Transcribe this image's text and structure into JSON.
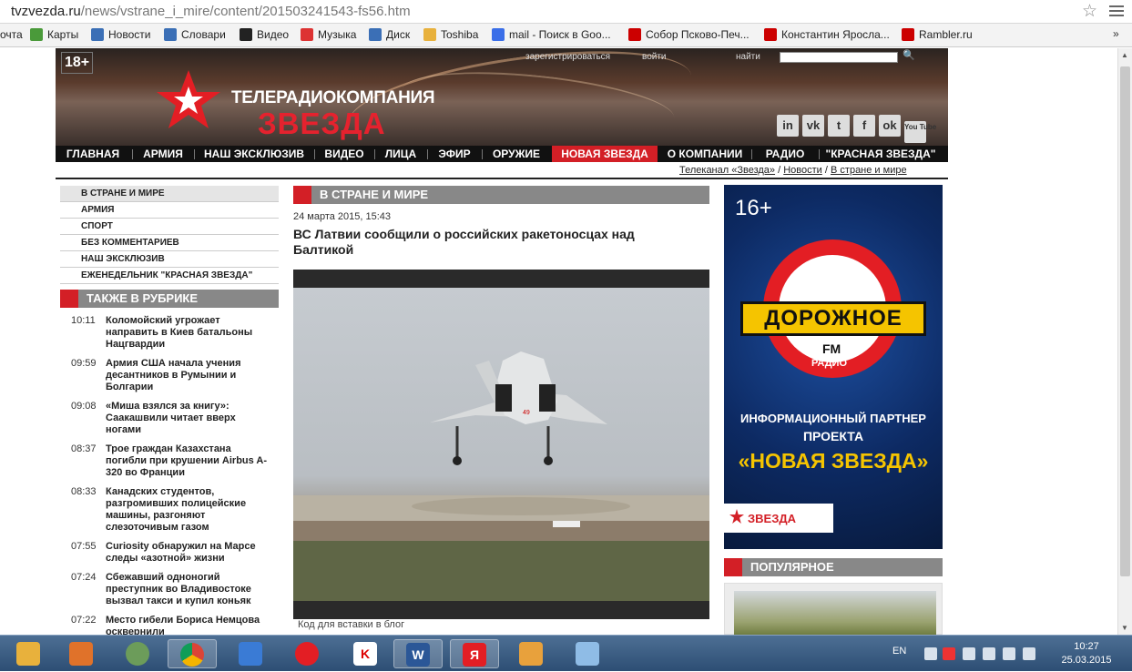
{
  "browser": {
    "url_host": "tvzvezda.ru",
    "url_path": "/news/vstrane_i_mire/content/201503241543-fs56.htm",
    "bookmarks": [
      "очта",
      "Карты",
      "Новости",
      "Словари",
      "Видео",
      "Музыка",
      "Диск",
      "Toshiba",
      "mail - Поиск в Goo...",
      "Собор Псково-Печ...",
      "Константин Яросла...",
      "Rambler.ru"
    ],
    "bookmark_more": "»",
    "bookmark_icons": [
      "#c33",
      "#4a9a3a",
      "#3b6fb6",
      "#3b6fb6",
      "#222",
      "#d33",
      "#3b6fb6",
      "#e8b13c",
      "#3a6ee8",
      "#c00",
      "#c00",
      "#c00"
    ]
  },
  "header": {
    "age": "18+",
    "register": "зарегистрироваться",
    "login": "войти",
    "search": "найти",
    "brand_line1": "ТЕЛЕРАДИОКОМПАНИЯ",
    "brand_line2": "ЗВЕЗДА",
    "social": [
      "in",
      "vk",
      "t",
      "f",
      "ok",
      "You Tube"
    ]
  },
  "nav": {
    "items": [
      "ГЛАВНАЯ",
      "АРМИЯ",
      "НАШ ЭКСКЛЮЗИВ",
      "ВИДЕО",
      "ЛИЦА",
      "ЭФИР",
      "ОРУЖИЕ",
      "НОВАЯ ЗВЕЗДА",
      "О КОМПАНИИ",
      "РАДИО",
      "\"КРАСНАЯ ЗВЕЗДА\""
    ],
    "active": "НОВАЯ ЗВЕЗДА"
  },
  "breadcrumbs": [
    "Телеканал «Звезда»",
    "Новости",
    "В стране и мире"
  ],
  "breadcrumb_sep": "/",
  "left_nav": [
    "В СТРАНЕ И МИРЕ",
    "АРМИЯ",
    "СПОРТ",
    "БЕЗ КОММЕНТАРИЕВ",
    "НАШ ЭКСКЛЮЗИВ",
    "ЕЖЕНЕДЕЛЬНИК \"КРАСНАЯ ЗВЕЗДА\""
  ],
  "also": {
    "title": "ТАКЖЕ В РУБРИКЕ",
    "items": [
      {
        "time": "10:11",
        "text": "Коломойский угрожает направить в Киев батальоны Нацгвардии"
      },
      {
        "time": "09:59",
        "text": "Армия США начала учения десантников в Румынии и Болгарии"
      },
      {
        "time": "09:08",
        "text": "«Миша взялся за книгу»: Саакашвили читает вверх ногами"
      },
      {
        "time": "08:37",
        "text": "Трое граждан Казахстана погибли при крушении Airbus A-320 во Франции"
      },
      {
        "time": "08:33",
        "text": "Канадских студентов, разгромивших полицейские машины, разгоняют слезоточивым газом"
      },
      {
        "time": "07:55",
        "text": "Curiosity обнаружил на Марсе следы «азотной» жизни"
      },
      {
        "time": "07:24",
        "text": "Сбежавший одноногий преступник во Владивостоке вызвал такси и купил коньяк"
      },
      {
        "time": "07:22",
        "text": "Место гибели Бориса Немцова осквернили"
      }
    ]
  },
  "article": {
    "section": "В СТРАНЕ И МИРЕ",
    "date": "24 марта 2015, 15:43",
    "title": "ВС Латвии сообщили о российских ракетоносцах над Балтикой",
    "embed": "Код для вставки в блог",
    "aircraft_number": "49"
  },
  "ad": {
    "age": "16+",
    "name": "ДОРОЖНОЕ",
    "fm": "FM",
    "radio": "РАДИО",
    "line1": "ИНФОРМАЦИОННЫЙ ПАРТНЕР",
    "line2": "ПРОЕКТА",
    "line3": "«НОВАЯ ЗВЕЗДА»",
    "footer": "ЗВЕЗДА"
  },
  "popular": {
    "title": "ПОПУЛЯРНОЕ"
  },
  "taskbar": {
    "apps": [
      "folder",
      "media",
      "browser",
      "chrome",
      "mail",
      "yandex",
      "kaspersky",
      "word",
      "yandex-2",
      "app",
      "paint"
    ],
    "app_labels": [
      "",
      "",
      "",
      "",
      "",
      "",
      "K",
      "W",
      "Я",
      "",
      ""
    ],
    "lang": "EN",
    "time": "10:27",
    "date": "25.03.2015"
  }
}
